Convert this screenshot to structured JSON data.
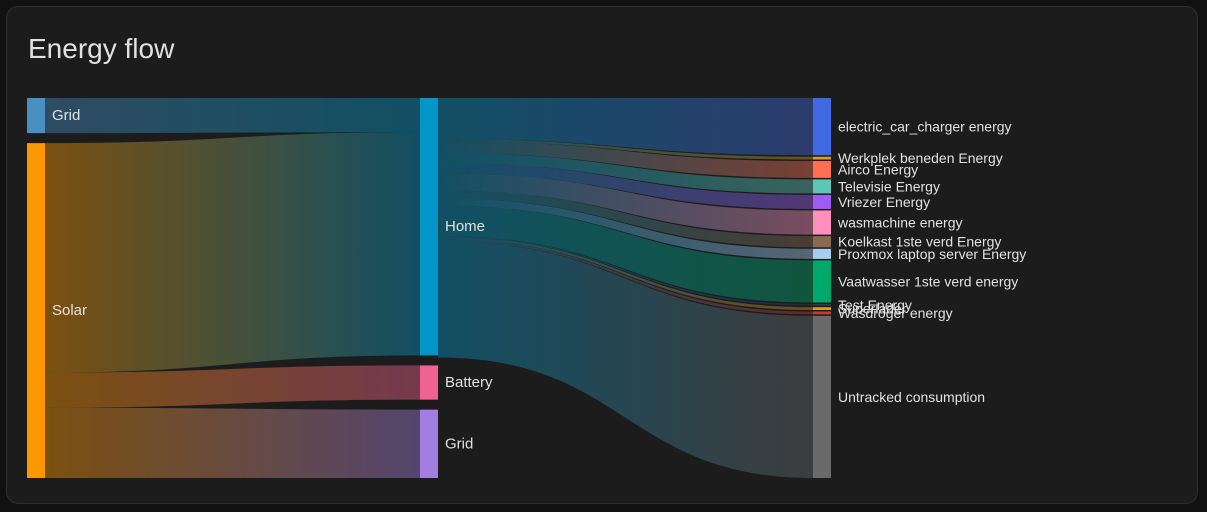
{
  "card": {
    "title": "Energy flow"
  },
  "chart_data": {
    "type": "sankey",
    "title": "Energy flow",
    "columns": [
      [
        {
          "id": "grid_in",
          "label": "Grid",
          "value": 8.5,
          "color": "#488fc2"
        },
        {
          "id": "solar",
          "label": "Solar",
          "value": 81,
          "color": "#ff9800"
        }
      ],
      [
        {
          "id": "home",
          "label": "Home",
          "value": 64,
          "color": "#0296c8"
        },
        {
          "id": "battery",
          "label": "Battery",
          "value": 8.5,
          "color": "#f06292"
        },
        {
          "id": "grid_out",
          "label": "Grid",
          "value": 17,
          "color": "#a17ee0"
        }
      ],
      [
        {
          "id": "ev",
          "label": "electric_car_charger energy",
          "value": 10.2,
          "color": "#4169e1"
        },
        {
          "id": "werkplek",
          "label": "Werkplek beneden Energy",
          "value": 0.5,
          "color": "#d4a020"
        },
        {
          "id": "airco",
          "label": "Airco Energy",
          "value": 3.0,
          "color": "#ff7050"
        },
        {
          "id": "tv",
          "label": "Televisie Energy",
          "value": 2.5,
          "color": "#5fc6b5"
        },
        {
          "id": "vriezer",
          "label": "Vriezer Energy",
          "value": 2.5,
          "color": "#9e5cf2"
        },
        {
          "id": "wasmachine",
          "label": "wasmachine energy",
          "value": 4.3,
          "color": "#ff8fbd"
        },
        {
          "id": "koelkast",
          "label": "Koelkast 1ste verd Energy",
          "value": 2.0,
          "color": "#8a6a50"
        },
        {
          "id": "proxmox",
          "label": "Proxmox laptop server Energy",
          "value": 1.8,
          "color": "#a8ccf0"
        },
        {
          "id": "vaatwasser",
          "label": "Vaatwasser 1ste verd energy",
          "value": 7.5,
          "color": "#00a86b"
        },
        {
          "id": "test",
          "label": "Test Energy",
          "value": 0.3,
          "color": "#303a60"
        },
        {
          "id": "superlader",
          "label": "Superlader",
          "value": 0.5,
          "color": "#d4a020"
        },
        {
          "id": "wasdroger",
          "label": "Wasdroger energy",
          "value": 0.5,
          "color": "#d03838"
        },
        {
          "id": "untracked",
          "label": "Untracked consumption",
          "value": 28.9,
          "color": "#6a6a6a"
        }
      ]
    ],
    "links": [
      {
        "source": "grid_in",
        "target": "home",
        "value": 8.5
      },
      {
        "source": "solar",
        "target": "home",
        "value": 55.5
      },
      {
        "source": "solar",
        "target": "battery",
        "value": 8.5
      },
      {
        "source": "solar",
        "target": "grid_out",
        "value": 17
      },
      {
        "source": "home",
        "target": "ev",
        "value": 10.2
      },
      {
        "source": "home",
        "target": "werkplek",
        "value": 0.5
      },
      {
        "source": "home",
        "target": "airco",
        "value": 3.0
      },
      {
        "source": "home",
        "target": "tv",
        "value": 2.5
      },
      {
        "source": "home",
        "target": "vriezer",
        "value": 2.5
      },
      {
        "source": "home",
        "target": "wasmachine",
        "value": 4.3
      },
      {
        "source": "home",
        "target": "koelkast",
        "value": 2.0
      },
      {
        "source": "home",
        "target": "proxmox",
        "value": 1.8
      },
      {
        "source": "home",
        "target": "vaatwasser",
        "value": 7.5
      },
      {
        "source": "home",
        "target": "test",
        "value": 0.3
      },
      {
        "source": "home",
        "target": "superlader",
        "value": 0.5
      },
      {
        "source": "home",
        "target": "wasdroger",
        "value": 0.5
      },
      {
        "source": "home",
        "target": "untracked",
        "value": 28.9
      }
    ]
  }
}
